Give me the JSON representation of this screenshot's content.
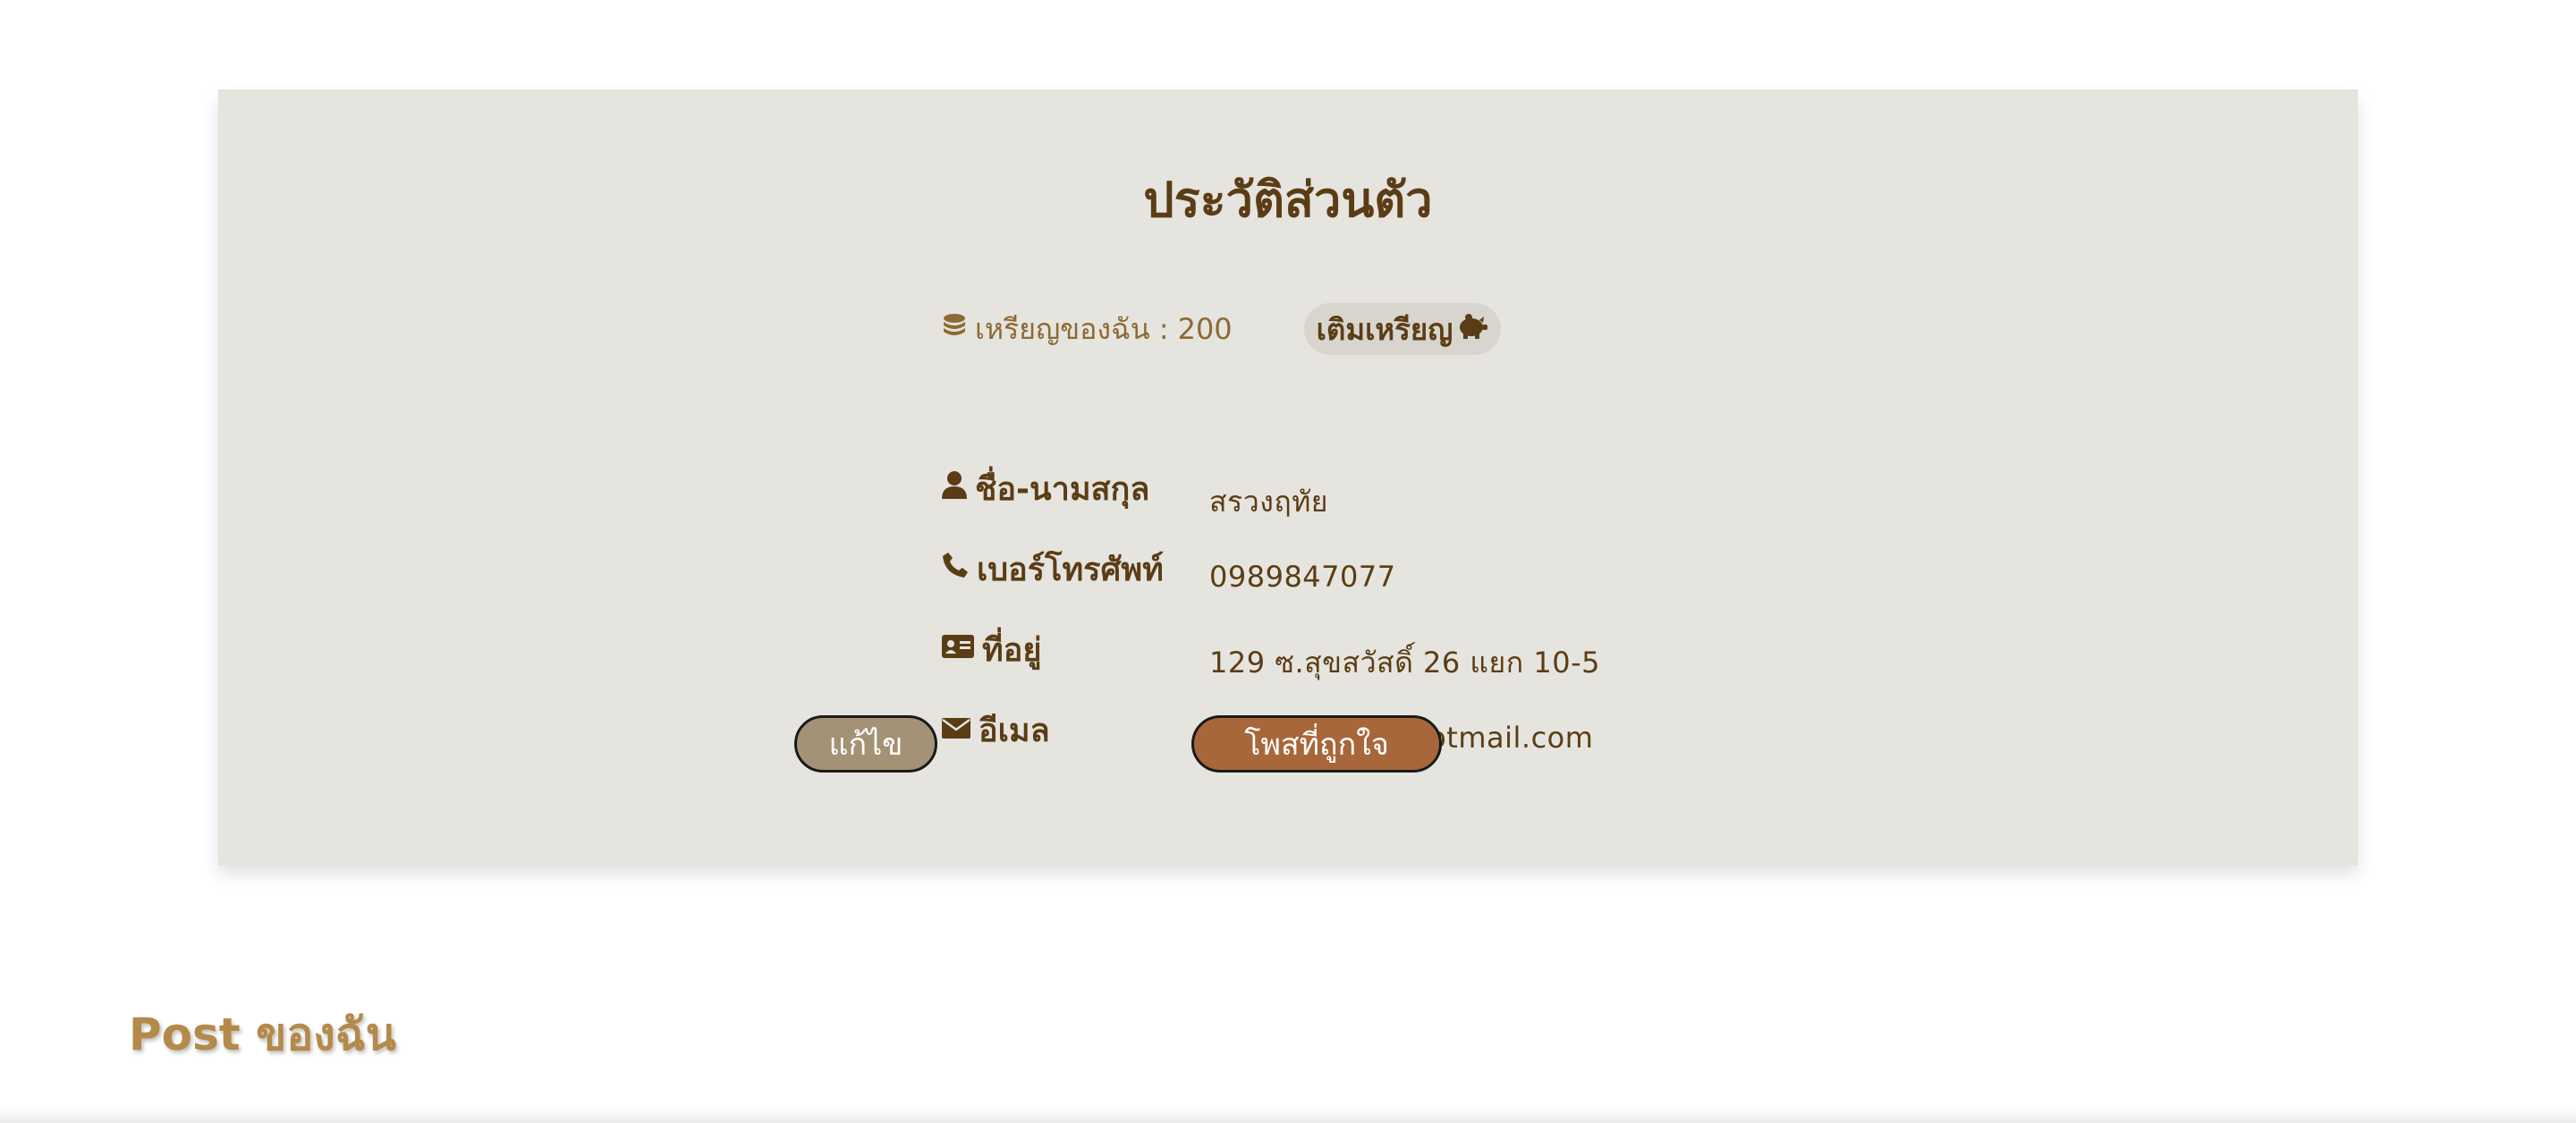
{
  "profile": {
    "title": "ประวัติส่วนตัว",
    "coins": {
      "label": "เหรียญของฉัน :",
      "value": "200",
      "icon": "coins-icon",
      "topup_label": "เติมเหรียญ",
      "topup_icon": "piggy-bank-icon"
    },
    "fields": {
      "name": {
        "label": "ชื่อ-นามสกุล",
        "value": "สรวงฤทัย",
        "icon": "user-icon"
      },
      "phone": {
        "label": "เบอร์โทรศัพท์",
        "value": "0989847077",
        "icon": "phone-icon"
      },
      "address": {
        "label": "ที่อยู่",
        "value": "129 ซ.สุขสวัสดิ์ 26 แยก 10-5",
        "icon": "id-card-icon"
      },
      "email": {
        "label": "อีเมล",
        "value": "june_25431@hotmail.com",
        "icon": "envelope-icon"
      }
    },
    "buttons": {
      "edit": "แก้ไข",
      "liked_posts": "โพสที่ถูกใจ"
    }
  },
  "posts_section": {
    "heading": "Post ของฉัน"
  },
  "colors": {
    "card_background": "#e6e4df",
    "text_brown": "#5b3d15",
    "edit_button": "#a39275",
    "liked_button": "#a8673a",
    "heading_gold": "#b48a4a"
  }
}
